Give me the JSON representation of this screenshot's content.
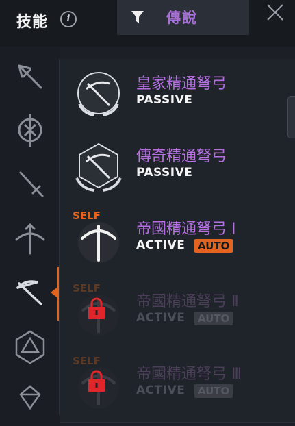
{
  "header": {
    "title": "技能",
    "info_icon": "info-icon",
    "filter": {
      "icon": "filter-icon",
      "label": "傳說"
    },
    "close_icon": "close-icon"
  },
  "sidebar": {
    "tabs": [
      {
        "icon": "trident-icon",
        "selected": false
      },
      {
        "icon": "shield-emblem-icon",
        "selected": false
      },
      {
        "icon": "sword-icon",
        "selected": false
      },
      {
        "icon": "bow-icon",
        "selected": false
      },
      {
        "icon": "crossbow-icon",
        "selected": true
      },
      {
        "icon": "polyhedron-icon",
        "selected": false
      },
      {
        "icon": "crystal-icon",
        "selected": false
      }
    ]
  },
  "skills": [
    {
      "name": "皇家精通弩弓",
      "type": "PASSIVE",
      "auto": "",
      "self": "",
      "locked": false
    },
    {
      "name": "傳奇精通弩弓",
      "type": "PASSIVE",
      "auto": "",
      "self": "",
      "locked": false
    },
    {
      "name": "帝國精通弩弓 Ⅰ",
      "type": "ACTIVE",
      "auto": "AUTO",
      "self": "SELF",
      "locked": false
    },
    {
      "name": "帝國精通弩弓 Ⅱ",
      "type": "ACTIVE",
      "auto": "AUTO",
      "self": "SELF",
      "locked": true
    },
    {
      "name": "帝國精通弩弓 Ⅲ",
      "type": "ACTIVE",
      "auto": "AUTO",
      "self": "SELF",
      "locked": true
    }
  ],
  "colors": {
    "accent": "#e2641e",
    "legendary": "#b56fe0",
    "lock": "#e0262a"
  }
}
